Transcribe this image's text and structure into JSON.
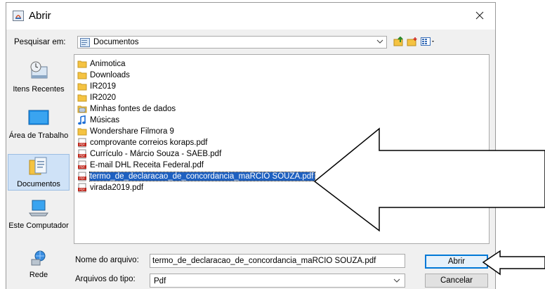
{
  "window": {
    "title": "Abrir"
  },
  "lookin": {
    "label": "Pesquisar em:",
    "value": "Documentos"
  },
  "places": [
    {
      "label": "Itens Recentes",
      "icon": "recent-items-icon"
    },
    {
      "label": "Área de Trabalho",
      "icon": "desktop-icon"
    },
    {
      "label": "Documentos",
      "icon": "documents-icon"
    },
    {
      "label": "Este Computador",
      "icon": "computer-icon"
    },
    {
      "label": "Rede",
      "icon": "network-icon"
    }
  ],
  "files": [
    {
      "name": "Animotica",
      "type": "folder"
    },
    {
      "name": "Downloads",
      "type": "folder"
    },
    {
      "name": "IR2019",
      "type": "folder"
    },
    {
      "name": "IR2020",
      "type": "folder"
    },
    {
      "name": "Minhas fontes de dados",
      "type": "datasource"
    },
    {
      "name": "Músicas",
      "type": "music"
    },
    {
      "name": "Wondershare Filmora 9",
      "type": "folder"
    },
    {
      "name": "comprovante correios koraps.pdf",
      "type": "pdf"
    },
    {
      "name": "Currículo - Márcio Souza - SAEB.pdf",
      "type": "pdf"
    },
    {
      "name": "E-mail DHL Receita Federal.pdf",
      "type": "pdf"
    },
    {
      "name": "termo_de_declaracao_de_concordancia_maRCIO SOUZA.pdf",
      "type": "pdf",
      "selected": true
    },
    {
      "name": "virada2019.pdf",
      "type": "pdf"
    }
  ],
  "filename": {
    "label": "Nome do arquivo:",
    "value": "termo_de_declaracao_de_concordancia_maRCIO SOUZA.pdf"
  },
  "filetype": {
    "label": "Arquivos do tipo:",
    "value": "Pdf"
  },
  "buttons": {
    "open": "Abrir",
    "cancel": "Cancelar"
  },
  "colors": {
    "selection": "#1e60c0",
    "dialog_bg": "#f0f0f0",
    "folder": "#f5c342",
    "pdf": "#c0281e"
  }
}
